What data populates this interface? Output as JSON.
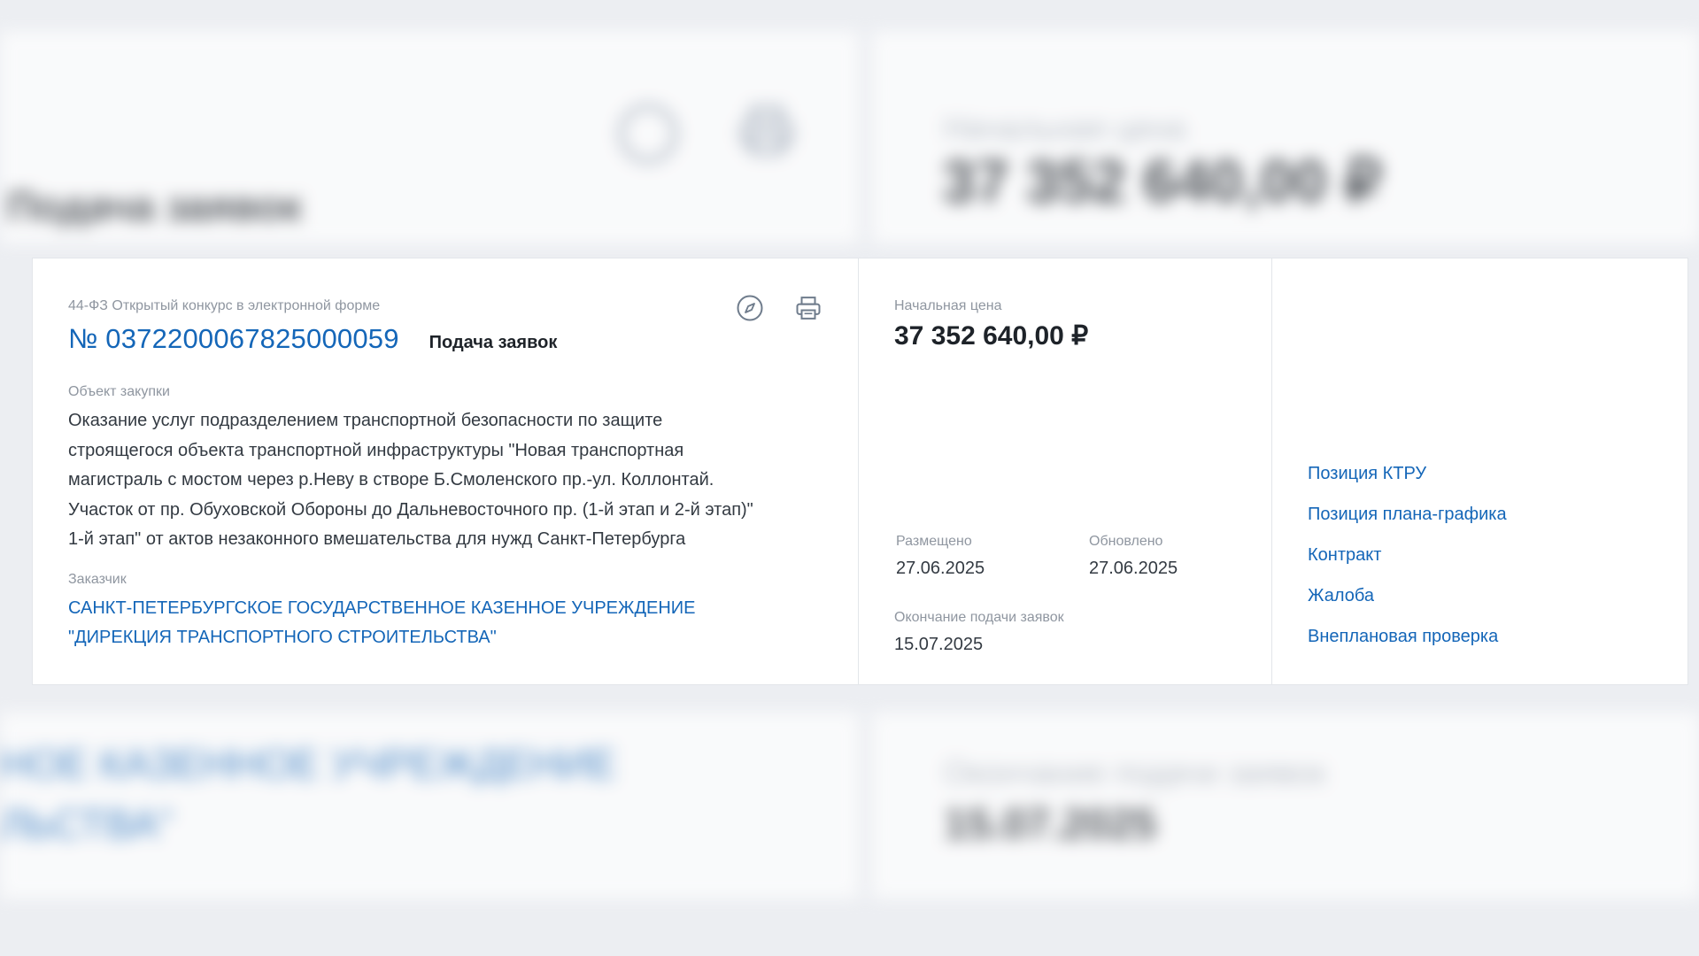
{
  "procurement": {
    "law_and_type": "44-ФЗ Открытый конкурс в электронной форме",
    "number": "№ 0372200067825000059",
    "stage": "Подача заявок",
    "object_label": "Объект закупки",
    "object_lines": [
      "Оказание услуг подразделением транспортной безопасности по защите",
      "строящегося объекта транспортной инфраструктуры \"Новая транспортная",
      "магистраль с мостом через р.Неву в створе Б.Смоленского пр.-ул. Коллонтай.",
      "Участок от пр. Обуховской Обороны до Дальневосточного пр. (1-й этап и 2-й этап)\"",
      "1-й этап\" от актов незаконного вмешательства для нужд Санкт-Петербурга"
    ],
    "customer_label": "Заказчик",
    "customer_lines": [
      "САНКТ-ПЕТЕРБУРГСКОЕ ГОСУДАРСТВЕННОЕ КАЗЕННОЕ УЧРЕЖДЕНИЕ",
      "\"ДИРЕКЦИЯ ТРАНСПОРТНОГО СТРОИТЕЛЬСТВА\""
    ]
  },
  "price": {
    "label": "Начальная цена",
    "value": "37 352 640,00 ₽"
  },
  "dates": {
    "placed_label": "Размещено",
    "placed_value": "27.06.2025",
    "updated_label": "Обновлено",
    "updated_value": "27.06.2025",
    "deadline_label": "Окончание подачи заявок",
    "deadline_value": "15.07.2025"
  },
  "links": [
    "Позиция КТРУ",
    "Позиция плана-графика",
    "Контракт",
    "Жалоба",
    "Внеплановая проверка"
  ],
  "background": {
    "stage": "Подача заявок",
    "price_label": "Начальная цена",
    "price_value": "37 352 640,00 ₽",
    "customer_line_1": "НОЕ КАЗЕННОЕ УЧРЕЖДЕНИЕ",
    "customer_line_2": "ЛЬСТВА\"",
    "deadline_label": "Окончание подачи заявок",
    "deadline_value": "15.07.2025"
  },
  "icons": {
    "compass": "compass-icon",
    "printer": "printer-icon"
  },
  "colors": {
    "link": "#1466b8",
    "text": "#333a42",
    "muted": "#8f96a0",
    "page_bg": "#eceef2"
  }
}
